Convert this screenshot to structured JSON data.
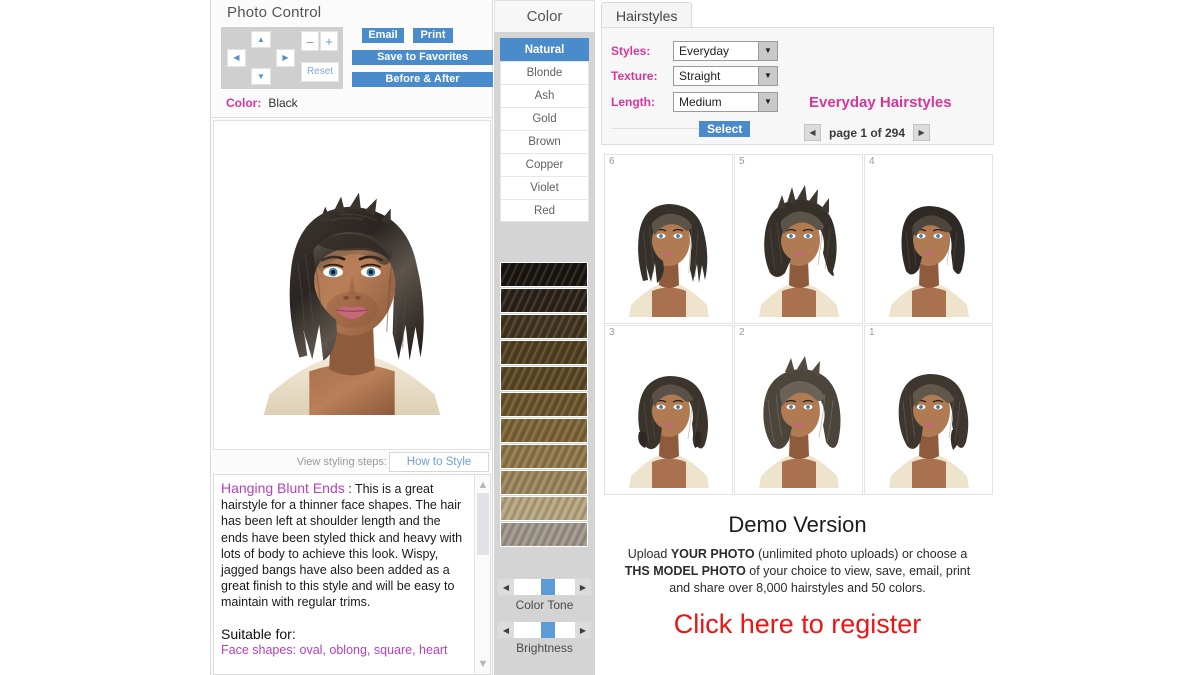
{
  "photo_control": {
    "title": "Photo Control",
    "dpad": {
      "up": "up-arrow",
      "down": "down-arrow",
      "left": "left-arrow",
      "right": "right-arrow",
      "zoom_out": "–",
      "zoom_in": "+",
      "reset": "Reset"
    },
    "buttons": {
      "email": "Email",
      "print": "Print",
      "save_to_favorites": "Save to Favorites",
      "before_after": "Before & After"
    },
    "color_label": "Color:",
    "color_value": "Black",
    "accent_pink": "#d6369b",
    "accent_blue": "#4a8bcc"
  },
  "styling": {
    "view_steps_label": "View styling steps:",
    "how_to_style": "How to Style"
  },
  "description": {
    "title": "Hanging Blunt Ends",
    "separator": " : ",
    "body": "This is a great hairstyle for a thinner face shapes. The hair has been left at shoulder length and the ends have been styled thick and heavy with lots of body to achieve this look. Wispy, jagged bangs have also been added as a great finish to this style and will be easy to maintain with regular trims.",
    "suitable_heading": "Suitable for:",
    "face_shapes": "Face shapes: oval, oblong, square, heart"
  },
  "color_panel": {
    "header": "Color",
    "options": [
      {
        "label": "Natural",
        "selected": true
      },
      {
        "label": "Blonde",
        "selected": false
      },
      {
        "label": "Ash",
        "selected": false
      },
      {
        "label": "Gold",
        "selected": false
      },
      {
        "label": "Brown",
        "selected": false
      },
      {
        "label": "Copper",
        "selected": false
      },
      {
        "label": "Violet",
        "selected": false
      },
      {
        "label": "Red",
        "selected": false
      }
    ],
    "swatches": [
      "#191410",
      "#2b2219",
      "#43351f",
      "#51401f",
      "#5a4724",
      "#6b542c",
      "#7d6436",
      "#8f7748",
      "#9b855a",
      "#b6a57f",
      "#9e968a"
    ],
    "sliders": [
      {
        "label": "Color Tone",
        "value": 45
      },
      {
        "label": "Brightness",
        "value": 45
      }
    ]
  },
  "hairstyles": {
    "tab": "Hairstyles",
    "filters": [
      {
        "label": "Styles:",
        "value": "Everyday"
      },
      {
        "label": "Texture:",
        "value": "Straight"
      },
      {
        "label": "Length:",
        "value": "Medium"
      }
    ],
    "select_button": "Select",
    "category_title": "Everyday Hairstyles",
    "pager": {
      "prev": "prev-page",
      "next": "next-page",
      "label": "page 1 of 294"
    },
    "thumbnails": [
      {
        "number": "6"
      },
      {
        "number": "5"
      },
      {
        "number": "4"
      },
      {
        "number": "3"
      },
      {
        "number": "2"
      },
      {
        "number": "1"
      }
    ]
  },
  "demo": {
    "title": "Demo Version",
    "line1_a": "Upload ",
    "line1_b": "YOUR PHOTO",
    "line1_c": " (unlimited photo uploads)",
    "line2_a": "or choose a ",
    "line2_b": "THS MODEL PHOTO",
    "line2_c": " of your choice",
    "line3": "to view, save, email, print and share over 8,000",
    "line4": "hairstyles and 50 colors.",
    "register": "Click here to register",
    "register_color": "#ee1414"
  }
}
